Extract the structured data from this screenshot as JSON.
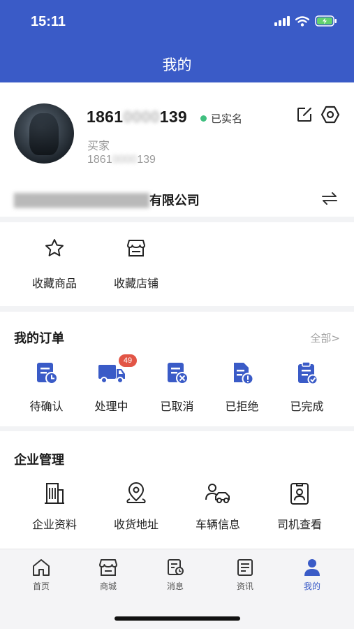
{
  "status_bar": {
    "time": "15:11"
  },
  "header": {
    "title": "我的"
  },
  "profile": {
    "phone_prefix": "1861",
    "phone_masked": "0000",
    "phone_suffix": "139",
    "verified_label": "已实名",
    "role": "买家",
    "phone_sub_prefix": "1861",
    "phone_sub_masked": "0000",
    "phone_sub_suffix": "139",
    "company_masked": "██████████████",
    "company_suffix": "有限公司"
  },
  "favorites": [
    {
      "label": "收藏商品",
      "icon": "star-icon"
    },
    {
      "label": "收藏店铺",
      "icon": "store-icon"
    }
  ],
  "orders": {
    "title": "我的订单",
    "all_link": "全部>",
    "items": [
      {
        "label": "待确认",
        "icon": "pending-confirm-icon"
      },
      {
        "label": "处理中",
        "icon": "truck-icon",
        "badge": "49"
      },
      {
        "label": "已取消",
        "icon": "cancelled-icon"
      },
      {
        "label": "已拒绝",
        "icon": "rejected-icon"
      },
      {
        "label": "已完成",
        "icon": "completed-icon"
      }
    ]
  },
  "enterprise": {
    "title": "企业管理",
    "items": [
      {
        "label": "企业资料",
        "icon": "building-icon"
      },
      {
        "label": "收货地址",
        "icon": "location-icon"
      },
      {
        "label": "车辆信息",
        "icon": "vehicle-icon"
      },
      {
        "label": "司机查看",
        "icon": "driver-card-icon"
      }
    ]
  },
  "tabbar": {
    "items": [
      {
        "label": "首页",
        "icon": "home-icon"
      },
      {
        "label": "商城",
        "icon": "mall-icon"
      },
      {
        "label": "消息",
        "icon": "message-icon"
      },
      {
        "label": "资讯",
        "icon": "news-icon"
      },
      {
        "label": "我的",
        "icon": "profile-icon",
        "active": true
      }
    ]
  },
  "colors": {
    "brand": "#3a5bc7",
    "badge": "#e25546",
    "verified": "#3fbf7f"
  }
}
